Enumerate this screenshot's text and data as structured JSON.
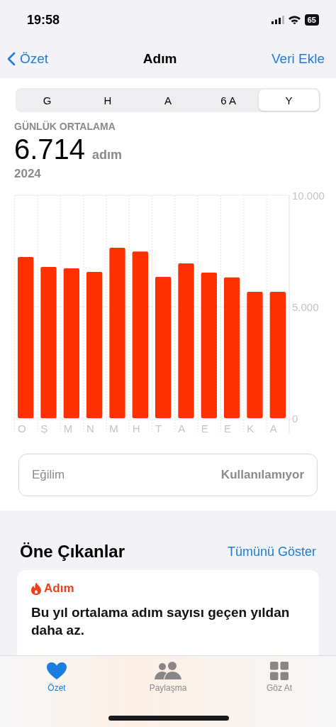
{
  "status_bar": {
    "time": "19:58",
    "battery": "65"
  },
  "nav": {
    "back": "Özet",
    "title": "Adım",
    "action": "Veri Ekle"
  },
  "segments": [
    {
      "label": "G",
      "selected": false
    },
    {
      "label": "H",
      "selected": false
    },
    {
      "label": "A",
      "selected": false
    },
    {
      "label": "6 A",
      "selected": false
    },
    {
      "label": "Y",
      "selected": true
    }
  ],
  "summary": {
    "caption": "GÜNLÜK ORTALAMA",
    "value": "6.714",
    "unit": "adım",
    "period": "2024"
  },
  "chart_data": {
    "type": "bar",
    "categories": [
      "O",
      "Ş",
      "M",
      "N",
      "M",
      "H",
      "T",
      "A",
      "E",
      "E",
      "K",
      "A"
    ],
    "series": [
      {
        "color": "#ff3000",
        "values": [
          7230,
          6780,
          6720,
          6560,
          7640,
          7480,
          6340,
          6940,
          6530,
          6310,
          5670,
          5670
        ]
      }
    ],
    "ylim": [
      0,
      10000
    ],
    "yticks": [
      {
        "value": 0,
        "label": "0"
      },
      {
        "value": 5000,
        "label": "5.000"
      },
      {
        "value": 10000,
        "label": "10.000"
      }
    ]
  },
  "trend": {
    "label": "Eğilim",
    "value": "Kullanılamıyor"
  },
  "highlights": {
    "title": "Öne Çıkanlar",
    "action": "Tümünü Göster",
    "cards": [
      {
        "category": "Adım",
        "text": "Bu yıl ortalama adım sayısı geçen yıldan daha az."
      }
    ]
  },
  "tab_bar": [
    {
      "label": "Özet",
      "kind": "heart",
      "selected": true
    },
    {
      "label": "Paylaşma",
      "kind": "people",
      "selected": false
    },
    {
      "label": "Göz At",
      "kind": "grid",
      "selected": false
    }
  ]
}
